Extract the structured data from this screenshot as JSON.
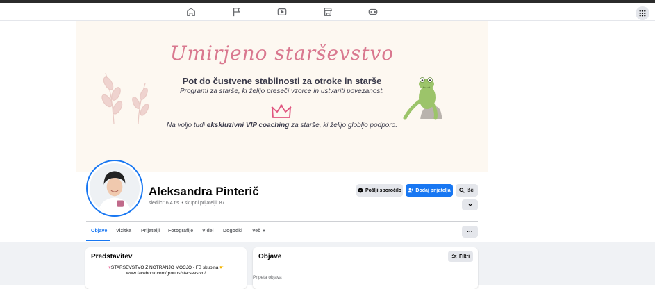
{
  "topnav": {
    "icons": [
      "home-icon",
      "flag-icon",
      "video-icon",
      "marketplace-icon",
      "gaming-icon"
    ],
    "menu_icon": "grid-menu-icon"
  },
  "cover": {
    "script_title": "Umirjeno starševstvo",
    "subtitle": "Pot do čustvene stabilnosti za otroke in starše",
    "tagline": "Programi za starše, ki želijo preseči vzorce in ustvariti povezanost.",
    "vip_prefix": "Na voljo tudi ",
    "vip_bold": "ekskluzivni VIP coaching",
    "vip_suffix": " za starše, ki želijo globljo podporo.",
    "accent": "#d9788f"
  },
  "profile": {
    "name": "Aleksandra Pinterič",
    "meta": "sledilci: 6,4 tis. • skupni prijatelji: 87"
  },
  "actions": {
    "message_label": "Pošlji sporočilo",
    "add_friend_label": "Dodaj prijatelja",
    "search_label": "Išči",
    "primary_color": "#1877f2"
  },
  "tabs": {
    "items": [
      "Objave",
      "Vizitka",
      "Prijatelji",
      "Fotografije",
      "Videi",
      "Dogodki",
      "Več"
    ],
    "more_dots": "···"
  },
  "intro": {
    "title": "Predstavitev",
    "line1": "STARŠEVSTVO Z NOTRANJO MOČJO - FB skupina",
    "line2": "www.facebook.com/groups/starsevstvo/"
  },
  "posts": {
    "title": "Objave",
    "filter_label": "Filtri",
    "pinned_label": "Pripeta objava"
  }
}
